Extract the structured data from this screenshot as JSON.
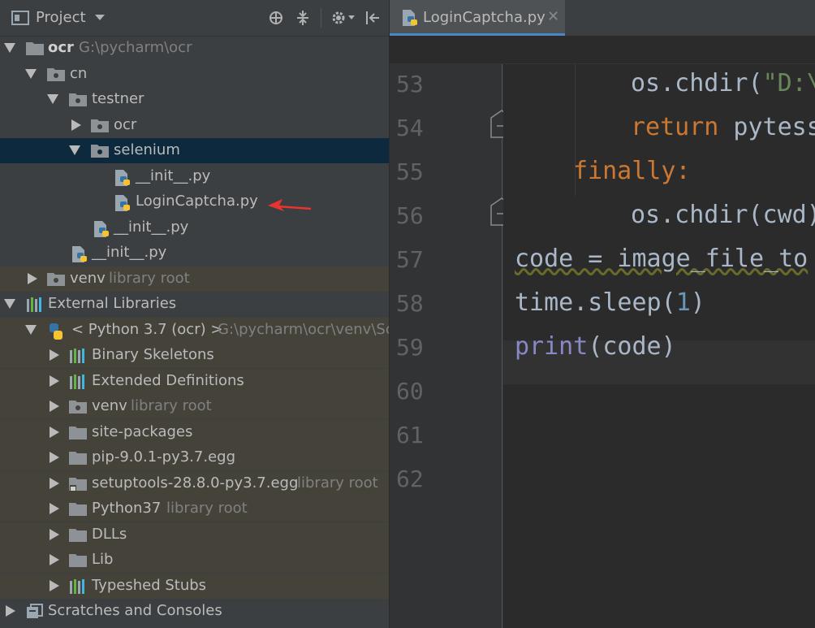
{
  "project_panel": {
    "title": "Project",
    "toolbar": [
      "locate-icon",
      "collapse-all-icon",
      "gear-icon",
      "hide-icon"
    ]
  },
  "tree": [
    {
      "label": "ocr",
      "hint": "G:\\pycharm\\ocr",
      "icon": "folder",
      "expanded": true,
      "bold": true
    },
    {
      "label": "cn",
      "icon": "package-folder",
      "expanded": true
    },
    {
      "label": "testner",
      "icon": "package-folder",
      "expanded": true
    },
    {
      "label": "ocr",
      "icon": "package-folder",
      "expanded": false
    },
    {
      "label": "selenium",
      "icon": "package-folder",
      "expanded": true,
      "selected": true
    },
    {
      "label": "__init__.py",
      "icon": "python-file"
    },
    {
      "label": "LoginCaptcha.py",
      "icon": "python-file",
      "annotated": true
    },
    {
      "label": "__init__.py",
      "icon": "python-file"
    },
    {
      "label": "__init__.py",
      "icon": "python-file"
    },
    {
      "label": "venv",
      "hint": "library root",
      "icon": "package-folder",
      "expanded": false
    },
    {
      "label": "External Libraries",
      "icon": "library"
    },
    {
      "label": "< Python 3.7 (ocr) >",
      "hint": "G:\\pycharm\\ocr\\venv\\Scri",
      "icon": "python-logo",
      "expanded": true
    },
    {
      "label": "Binary Skeletons",
      "icon": "library"
    },
    {
      "label": "Extended Definitions",
      "icon": "library"
    },
    {
      "label": "venv",
      "hint": "library root",
      "icon": "package-folder"
    },
    {
      "label": "site-packages",
      "icon": "folder"
    },
    {
      "label": "pip-9.0.1-py3.7.egg",
      "icon": "folder"
    },
    {
      "label": "setuptools-28.8.0-py3.7.egg",
      "hint": "library root",
      "icon": "locked-folder"
    },
    {
      "label": "Python37",
      "hint": "library root",
      "icon": "folder"
    },
    {
      "label": "DLLs",
      "icon": "folder"
    },
    {
      "label": "Lib",
      "icon": "folder"
    },
    {
      "label": "Typeshed Stubs",
      "icon": "library"
    },
    {
      "label": "Scratches and Consoles",
      "icon": "scratches"
    }
  ],
  "editor": {
    "tab_label": "LoginCaptcha.py",
    "line_numbers": [
      "53",
      "54",
      "55",
      "56",
      "57",
      "58",
      "59",
      "60",
      "61",
      "62"
    ],
    "lines": {
      "l53_a": "os.chdir(",
      "l53_b": "\"D:\\",
      "l54_kw": "return",
      "l54_b": " pytess",
      "l55_kw": "finally",
      "l55_b": ":",
      "l56": "os.chdir(cwd)",
      "l57": "code = image_file_to",
      "l58_a": "time.sleep(",
      "l58_num": "1",
      "l58_b": ")",
      "l59_bi": "print",
      "l59_b": "(code)"
    }
  },
  "colors": {
    "accent": "#4a88c7",
    "annotation_arrow": "#e8342f",
    "keyword": "#cc7832"
  }
}
